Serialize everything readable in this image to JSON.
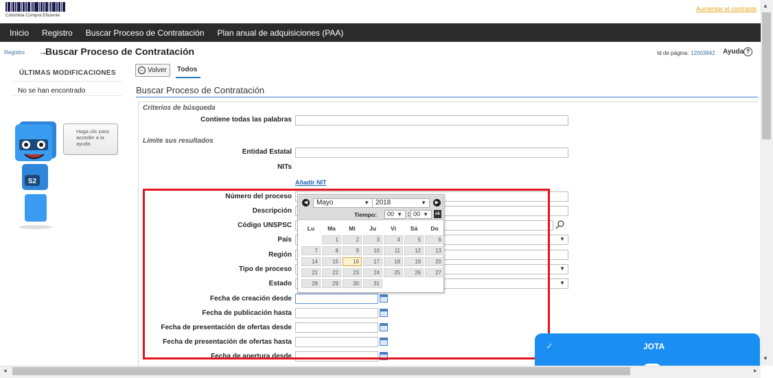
{
  "header": {
    "logo_text": "Colombia Compra Eficiente",
    "contrast_link": "Aumentar el contraste"
  },
  "nav": {
    "items": [
      "Inicio",
      "Registro",
      "Buscar Proceso de Contratación",
      "Plan anual de adquisiciones (PAA)"
    ]
  },
  "breadcrumb": {
    "parent": "Registro",
    "arrow": "→",
    "title": "Buscar Proceso de Contratación",
    "page_id_label": "Id de página:",
    "page_id_value": "12003842",
    "help_label": "Ayuda",
    "help_icon": "?"
  },
  "sidebar": {
    "heading": "ÚLTIMAS MODIFICACIONES",
    "empty_text": "No se han encontrado",
    "helper_bubble": "Haga clic para acceder a la ayuda",
    "robot_badge": "S2"
  },
  "toolbar": {
    "back_label": "Volver",
    "tab_label": "Todos"
  },
  "form": {
    "title": "Buscar Proceso de Contratación",
    "section_criteria": "Criterios de búsqueda",
    "section_limits": "Limite sus resultados",
    "add_nit_link": "Añadir NIT",
    "labels": {
      "all_words": "Contiene todas las palabras",
      "entity": "Entidad Estatal",
      "nits": "NITs",
      "process_number": "Número del proceso",
      "description": "Descripción",
      "unspsc": "Código UNSPSC",
      "country": "País",
      "region": "Región",
      "process_type": "Tipo de proceso",
      "state": "Estado",
      "created_from": "Fecha de creación desde",
      "published_to": "Fecha de publicación hasta",
      "offers_from": "Fecha de presentación de ofertas desde",
      "offers_to": "Fecha de presentación de ofertas hasta",
      "opening_from": "Fecha de apertura desde"
    }
  },
  "datepicker": {
    "month": "Mayo",
    "year": "2018",
    "time_label": "Tiempo:",
    "hour": "00",
    "minute": "00",
    "ok_label": "ok",
    "weekdays": [
      "Lu",
      "Ma",
      "Mi",
      "Ju",
      "Vi",
      "Sá",
      "Do"
    ],
    "days": [
      "1",
      "2",
      "3",
      "4",
      "5",
      "6",
      "7",
      "8",
      "9",
      "10",
      "11",
      "12",
      "13",
      "14",
      "15",
      "16",
      "17",
      "18",
      "19",
      "20",
      "21",
      "22",
      "23",
      "24",
      "25",
      "26",
      "27",
      "28",
      "29",
      "30",
      "31"
    ],
    "first_weekday_index": 1,
    "selected_day": "16"
  },
  "chat": {
    "label": "JOTA"
  },
  "colors": {
    "nav_bg": "#2b2b2b",
    "link": "#1a5fb4",
    "highlight": "#e3141b",
    "chat_bg": "#1a8ef2"
  }
}
